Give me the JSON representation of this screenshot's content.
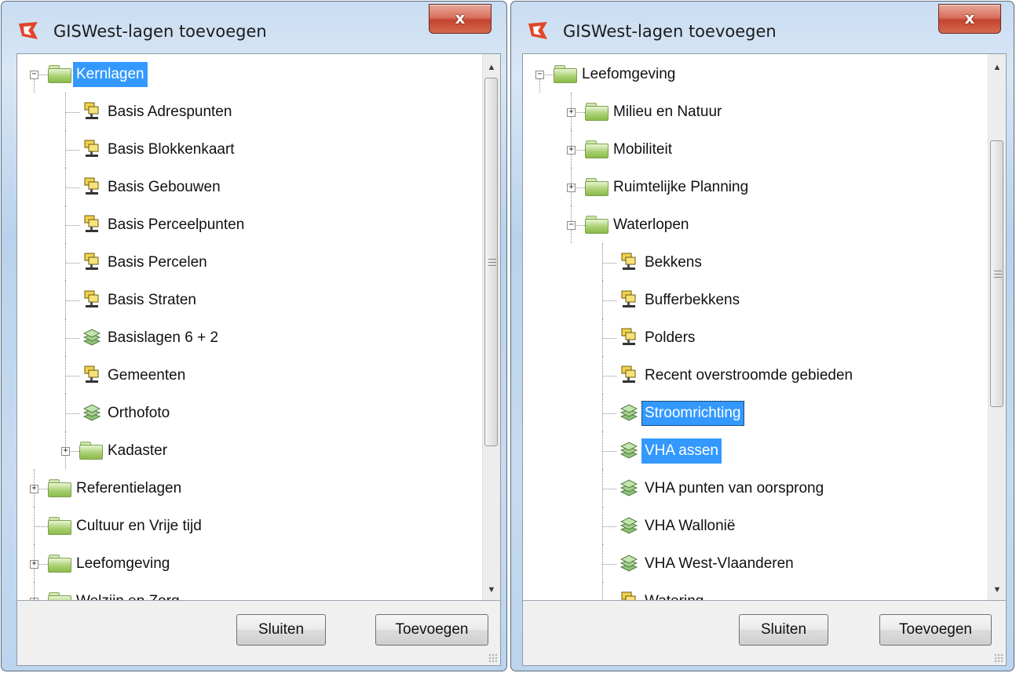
{
  "left_window": {
    "title": "GISWest-lagen toevoegen",
    "close_glyph": "x",
    "tree": [
      {
        "label": "Kernlagen",
        "level": 0,
        "kind": "folder",
        "expander": "−",
        "selected": true
      },
      {
        "label": "Basis Adrespunten",
        "level": 1,
        "kind": "server"
      },
      {
        "label": "Basis Blokkenkaart",
        "level": 1,
        "kind": "server"
      },
      {
        "label": "Basis Gebouwen",
        "level": 1,
        "kind": "server"
      },
      {
        "label": "Basis Perceelpunten",
        "level": 1,
        "kind": "server"
      },
      {
        "label": "Basis Percelen",
        "level": 1,
        "kind": "server"
      },
      {
        "label": "Basis Straten",
        "level": 1,
        "kind": "server"
      },
      {
        "label": "Basislagen 6 + 2",
        "level": 1,
        "kind": "layers"
      },
      {
        "label": "Gemeenten",
        "level": 1,
        "kind": "server"
      },
      {
        "label": "Orthofoto",
        "level": 1,
        "kind": "layers"
      },
      {
        "label": "Kadaster",
        "level": 1,
        "kind": "folder",
        "expander": "+"
      },
      {
        "label": "Referentielagen",
        "level": 0,
        "kind": "folder",
        "expander": "+"
      },
      {
        "label": "Cultuur en Vrije tijd",
        "level": 0,
        "kind": "folder"
      },
      {
        "label": "Leefomgeving",
        "level": 0,
        "kind": "folder",
        "expander": "+"
      },
      {
        "label": "Welzijn en Zorg",
        "level": 0,
        "kind": "folder",
        "expander": "+"
      }
    ],
    "buttons": {
      "close": "Sluiten",
      "add": "Toevoegen"
    }
  },
  "right_window": {
    "title": "GISWest-lagen toevoegen",
    "close_glyph": "x",
    "tree": [
      {
        "label": "Leefomgeving",
        "level": 0,
        "kind": "folder",
        "expander": "−"
      },
      {
        "label": "Milieu en Natuur",
        "level": 1,
        "kind": "folder",
        "expander": "+"
      },
      {
        "label": "Mobiliteit",
        "level": 1,
        "kind": "folder",
        "expander": "+"
      },
      {
        "label": "Ruimtelijke Planning",
        "level": 1,
        "kind": "folder",
        "expander": "+"
      },
      {
        "label": "Waterlopen",
        "level": 1,
        "kind": "folder",
        "expander": "−"
      },
      {
        "label": "Bekkens",
        "level": 2,
        "kind": "server"
      },
      {
        "label": "Bufferbekkens",
        "level": 2,
        "kind": "server"
      },
      {
        "label": "Polders",
        "level": 2,
        "kind": "server"
      },
      {
        "label": "Recent overstroomde gebieden",
        "level": 2,
        "kind": "server"
      },
      {
        "label": "Stroomrichting",
        "level": 2,
        "kind": "layers",
        "selected": true,
        "focused": true
      },
      {
        "label": "VHA assen",
        "level": 2,
        "kind": "layers",
        "selected": true
      },
      {
        "label": "VHA punten van oorsprong",
        "level": 2,
        "kind": "layers"
      },
      {
        "label": "VHA Wallonië",
        "level": 2,
        "kind": "layers"
      },
      {
        "label": "VHA West-Vlaanderen",
        "level": 2,
        "kind": "layers"
      },
      {
        "label": "Watering",
        "level": 2,
        "kind": "server"
      }
    ],
    "buttons": {
      "close": "Sluiten",
      "add": "Toevoegen"
    }
  },
  "icons": {
    "app": "giswest-logo-icon",
    "folder": "folder-icon",
    "server": "map-server-icon",
    "layers": "layer-stack-icon",
    "expand": "expand-plus-icon",
    "collapse": "collapse-minus-icon",
    "scroll_up": "scroll-up-arrow-icon",
    "scroll_down": "scroll-down-arrow-icon"
  },
  "colors": {
    "selection": "#3399ff",
    "close_button": "#c4442f",
    "folder_green": "#8bbb4a",
    "frame": "#c9dcf1"
  }
}
